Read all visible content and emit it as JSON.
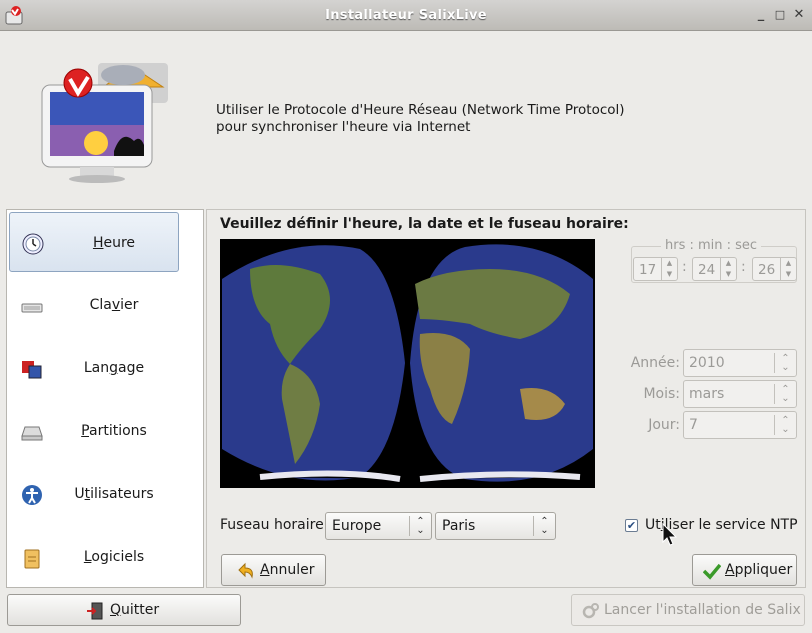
{
  "window": {
    "title": "Installateur SalixLive"
  },
  "header": {
    "line1": "Utiliser le Protocole d'Heure Réseau  (Network Time Protocol)",
    "line2": "pour synchroniser l'heure via Internet"
  },
  "sidebar": {
    "items": [
      {
        "pre": "",
        "ul": "H",
        "post": "eure",
        "icon": "clock-icon",
        "active": true
      },
      {
        "pre": "Cla",
        "ul": "v",
        "post": "ier",
        "icon": "keyboard-icon"
      },
      {
        "pre": "Lan",
        "ul": "g",
        "post": "age",
        "icon": "language-flags-icon"
      },
      {
        "pre": "",
        "ul": "P",
        "post": "artitions",
        "icon": "disk-icon"
      },
      {
        "pre": "U",
        "ul": "t",
        "post": "ilisateurs",
        "icon": "user-accessibility-icon"
      },
      {
        "pre": "",
        "ul": "L",
        "post": "ogiciels",
        "icon": "package-icon"
      }
    ]
  },
  "main": {
    "title": "Veuillez définir l'heure, la date et le fuseau horaire:",
    "time": {
      "legend": "hrs : min : sec",
      "hours": "17",
      "minutes": "24",
      "seconds": "26",
      "sep": ":"
    },
    "date": {
      "year_label": "Année:",
      "year": "2010",
      "month_label": "Mois:",
      "month": "mars",
      "day_label": "Jour:",
      "day": "7"
    },
    "timezone": {
      "label": "Fuseau horaire:",
      "region": "Europe",
      "city": "Paris"
    },
    "ntp": {
      "label_pre": "Ut",
      "label_ul": "i",
      "label_post": "liser le service NTP",
      "checked": true
    },
    "buttons": {
      "cancel_pre": "",
      "cancel_ul": "A",
      "cancel_post": "nnuler",
      "apply_pre": "",
      "apply_ul": "A",
      "apply_post": "ppliquer"
    }
  },
  "footer": {
    "quit_pre": "",
    "quit_ul": "Q",
    "quit_post": "uitter",
    "launch": "Lancer l'installation de Salix"
  },
  "colors": {
    "accent": "#5a7fae",
    "disabled": "#9b9a97",
    "map_ocean": "#2a3a8c"
  }
}
